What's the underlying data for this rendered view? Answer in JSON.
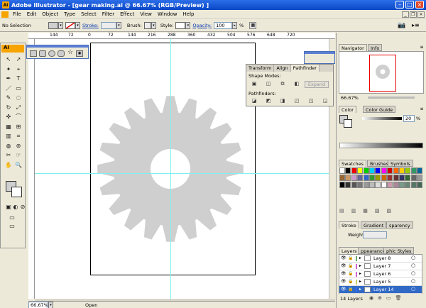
{
  "window": {
    "title": "Adobe Illustrator - [gear making.ai @ 66.67% (RGB/Preview) ]",
    "app_icon": "Ai"
  },
  "menu": [
    "File",
    "Edit",
    "Object",
    "Type",
    "Select",
    "Filter",
    "Effect",
    "View",
    "Window",
    "Help"
  ],
  "control_bar": {
    "selection": "No Selection",
    "stroke_label": "Stroke:",
    "brush_label": "Brush:",
    "style_label": "Style:",
    "opacity_label": "Opacity:",
    "opacity_value": "100",
    "percent": "%"
  },
  "ruler": {
    "ticks": [
      "144",
      "72",
      "0",
      "72",
      "144",
      "216",
      "288",
      "360",
      "432",
      "504",
      "576",
      "648",
      "720"
    ]
  },
  "tools": {
    "header": "Ai"
  },
  "pathfinder": {
    "tabs": [
      "Transform",
      "Align",
      "Pathfinder"
    ],
    "shape_modes_label": "Shape Modes:",
    "pathfinders_label": "Pathfinders:",
    "expand_label": "Expand"
  },
  "navigator": {
    "tabs": [
      "Navigator",
      "Info"
    ],
    "zoom": "66.67%"
  },
  "color_panel": {
    "tabs": [
      "Color",
      "Color Guide"
    ],
    "value": "20",
    "percent": "%"
  },
  "swatches_panel": {
    "tabs": [
      "Swatches",
      "Brushes",
      "Symbols"
    ]
  },
  "stroke_panel": {
    "tabs": [
      "Stroke",
      "Gradient",
      "sparency"
    ],
    "weight_label": "Weight:"
  },
  "layers_panel": {
    "tabs": [
      "Layers",
      "ppearance",
      "phic Styles"
    ],
    "layers": [
      "Layer 8",
      "Layer 7",
      "Layer 6",
      "Layer 5",
      "Layer 14"
    ],
    "count": "14 Layers"
  },
  "status_bar": {
    "zoom": "66.67%",
    "state": "Open"
  },
  "colors": {
    "gear": "#cfcfcf",
    "guide": "#7ff0f0",
    "title_blue": "#0a46c6",
    "ai_orange": "#f7a400",
    "selected_layer": "#316ac5"
  }
}
